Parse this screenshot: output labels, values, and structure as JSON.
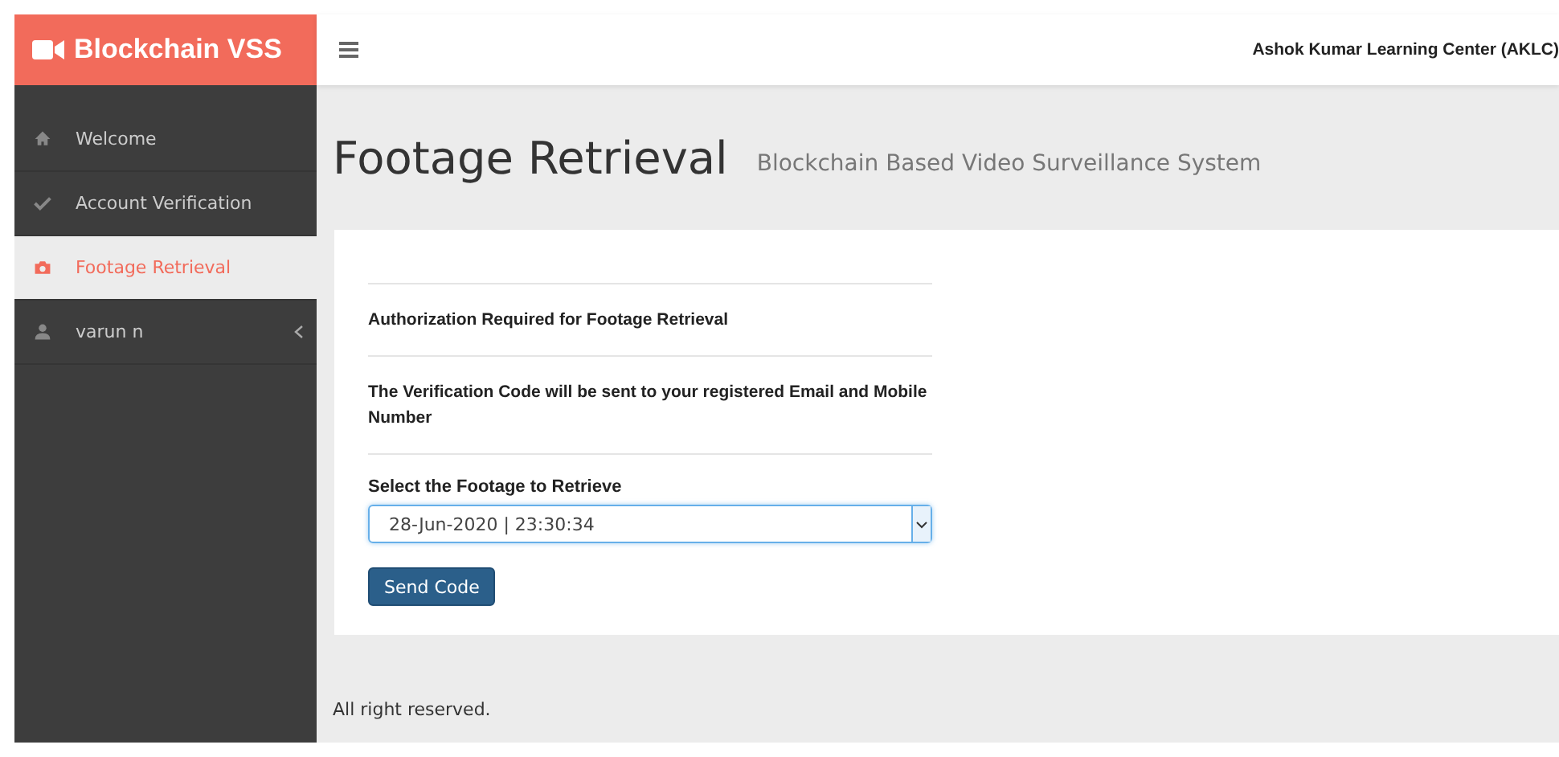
{
  "brand": {
    "title": "Blockchain VSS"
  },
  "header": {
    "organization": "Ashok Kumar Learning Center (AKLC)"
  },
  "sidebar": {
    "items": [
      {
        "label": "Welcome",
        "kind": "link",
        "selected": false
      },
      {
        "label": "Account Verification",
        "kind": "link",
        "selected": false
      },
      {
        "label": "Footage Retrieval",
        "kind": "link",
        "selected": true
      },
      {
        "label": "varun n",
        "kind": "submenu",
        "selected": false
      }
    ]
  },
  "page": {
    "title": "Footage Retrieval",
    "subtitle": "Blockchain Based Video Surveillance System"
  },
  "form": {
    "notices": [
      "Authorization Required for Footage Retrieval",
      "The Verification Code will be sent to your registered Email and Mobile Number"
    ],
    "select_label": "Select the Footage to Retrieve",
    "select_value": "28-Jun-2020 | 23:30:34",
    "button": "Send Code"
  },
  "footer": {
    "text": "All right reserved."
  }
}
